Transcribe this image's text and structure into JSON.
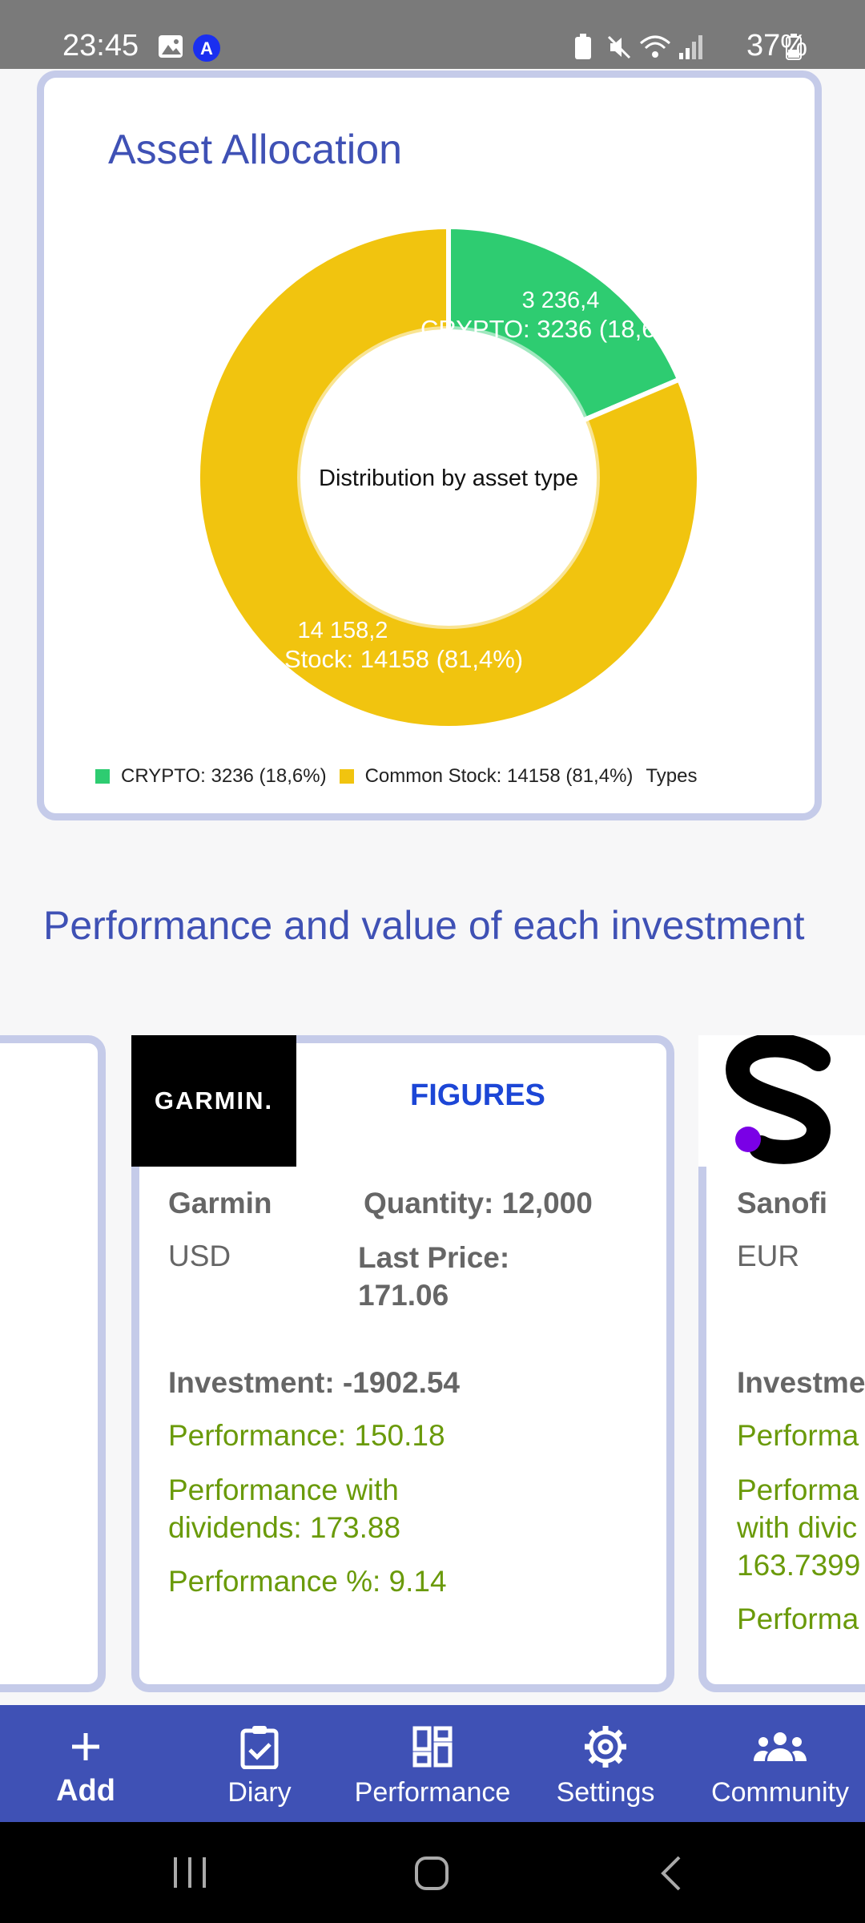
{
  "status_bar": {
    "time": "23:45",
    "battery": "37%",
    "icons": [
      "image-icon",
      "a-badge-icon",
      "battery-saver-icon",
      "mute-icon",
      "wifi-icon",
      "signal-icon",
      "battery-icon"
    ]
  },
  "allocation": {
    "title": "Asset Allocation",
    "center_label": "Distribution by asset type",
    "legend_suffix": "Types"
  },
  "chart_data": {
    "type": "pie",
    "title": "Asset Allocation",
    "subtitle": "Distribution by asset type",
    "slices": [
      {
        "label": "CRYPTO",
        "value": 3236.4,
        "value_text": "3 236,4",
        "slice_label": "CRYPTO: 3236 (18,6%)",
        "legend": "CRYPTO: 3236 (18,6%)",
        "color": "#2ecc71"
      },
      {
        "label": "Common Stock",
        "value": 14158.2,
        "value_text": "14 158,2",
        "slice_label": "Stock: 14158 (81,4%)",
        "legend": "Common Stock: 14158 (81,4%)",
        "color": "#f1c40f"
      }
    ]
  },
  "performance": {
    "section_title": "Performance and value of each investment"
  },
  "investments": [
    {
      "logo_text": "GARMIN.",
      "figures_label": "FIGURES",
      "name": "Garmin",
      "currency": "USD",
      "quantity": "Quantity: 12,000",
      "last_price_label": "Last Price:",
      "last_price": "171.06",
      "investment": "Investment: -1902.54",
      "performance": "Performance: 150.18",
      "perf_div_1": "Performance with",
      "perf_div_2": "dividends: 173.88",
      "performance_pct": "Performance %: 9.14"
    },
    {
      "name": "Sanofi",
      "currency": "EUR",
      "investment": "Investme",
      "performance": "Performa",
      "perf_div_1": "Performa",
      "perf_div_2": "with divic",
      "perf_div_3": "163.7399",
      "performance_pct": "Performa"
    }
  ],
  "bottom_nav": [
    {
      "label": "Add",
      "icon": "plus-icon"
    },
    {
      "label": "Diary",
      "icon": "clipboard-check-icon"
    },
    {
      "label": "Performance",
      "icon": "dashboard-icon"
    },
    {
      "label": "Settings",
      "icon": "gear-icon"
    },
    {
      "label": "Community",
      "icon": "group-icon"
    }
  ],
  "colors": {
    "primary": "#3f51b5",
    "crypto": "#2ecc71",
    "stock": "#f1c40f",
    "positive": "#6a9a0a",
    "figures": "#1c46d6"
  }
}
